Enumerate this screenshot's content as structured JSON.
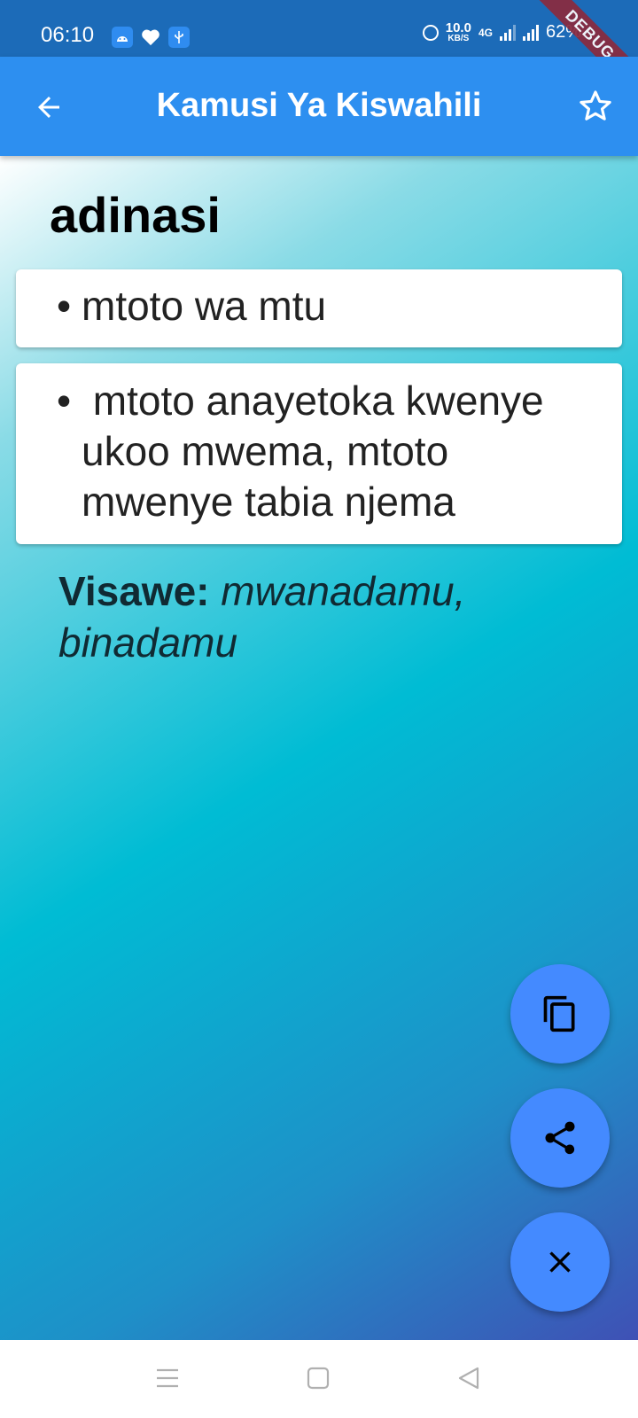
{
  "status_bar": {
    "time": "06:10",
    "speed_value": "10.0",
    "speed_unit": "KB/S",
    "network_label": "4G",
    "battery": "62%",
    "icons": [
      "android-icon",
      "heart-icon",
      "usb-icon",
      "alarm-icon",
      "signal-icon",
      "battery-icon"
    ]
  },
  "debug_banner": "DEBUG",
  "app_bar": {
    "title": "Kamusi Ya Kiswahili",
    "back_icon": "arrow-left-icon",
    "favorite_icon": "star-outline-icon"
  },
  "entry": {
    "word": "adinasi",
    "definitions": [
      {
        "bullet": "•",
        "text": "mtoto wa mtu"
      },
      {
        "bullet": "•",
        "text": " mtoto anayetoka kwenye ukoo mwema, mtoto mwenye tabia njema"
      }
    ],
    "synonyms_label": "Visawe:",
    "synonyms_text": "mwanadamu, binadamu"
  },
  "fabs": [
    {
      "icon": "copy-icon"
    },
    {
      "icon": "share-icon"
    },
    {
      "icon": "close-icon"
    }
  ],
  "nav_bar": {
    "icons": [
      "menu-icon",
      "home-icon",
      "back-triangle-icon"
    ]
  },
  "colors": {
    "status_bar": "#1c6bb8",
    "app_bar": "#2d8ff0",
    "fab": "#448aff",
    "gradient": [
      "#ffffff",
      "#00bcd4",
      "#3f51b5"
    ]
  }
}
